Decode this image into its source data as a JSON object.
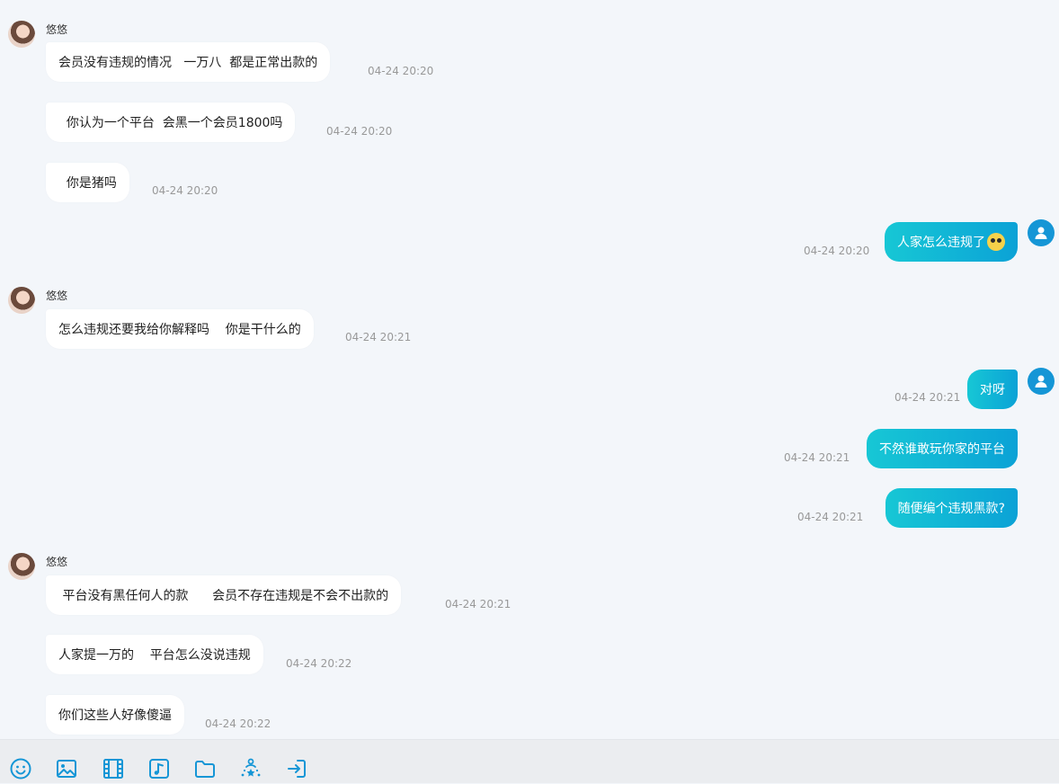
{
  "sender_name": "悠悠",
  "messages": [
    {
      "text": "会员没有违规的情况   一万八  都是正常出款的",
      "time": "04-24 20:20"
    },
    {
      "text": "  你认为一个平台  会黑一个会员1800吗",
      "time": "04-24 20:20"
    },
    {
      "text": "  你是猪吗",
      "time": "04-24 20:20"
    },
    {
      "text": "人家怎么违规了",
      "time": "04-24 20:20",
      "emoji": "flushed-face"
    },
    {
      "text": "怎么违规还要我给你解释吗    你是干什么的",
      "time": "04-24 20:21"
    },
    {
      "text": "对呀",
      "time": "04-24 20:21"
    },
    {
      "text": "不然谁敢玩你家的平台",
      "time": "04-24 20:21"
    },
    {
      "text": "随便编个违规黑款?",
      "time": "04-24 20:21"
    },
    {
      "text": " 平台没有黑任何人的款      会员不存在违规是不会不出款的",
      "time": "04-24 20:21"
    },
    {
      "text": "人家提一万的    平台怎么没说违规",
      "time": "04-24 20:22"
    },
    {
      "text": "你们这些人好像傻逼",
      "time": "04-24 20:22"
    }
  ],
  "toolbar": {
    "icons": [
      "emoji-icon",
      "image-icon",
      "video-icon",
      "music-icon",
      "folder-icon",
      "rating-icon",
      "exit-icon"
    ]
  },
  "colors": {
    "accent": "#0ba2d6",
    "bubble_out_start": "#17c7d5",
    "background": "#f3f6fa"
  }
}
